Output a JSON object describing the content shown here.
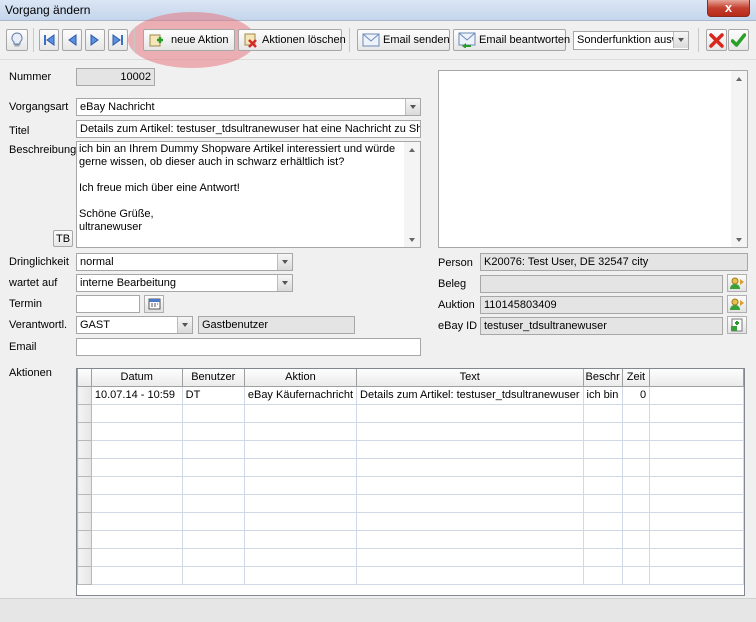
{
  "window": {
    "title": "Vorgang ändern",
    "close_label": "x"
  },
  "toolbar": {
    "neue_aktion": "neue Aktion",
    "aktionen_loeschen": "Aktionen löschen",
    "email_senden": "Email senden",
    "email_beantworten": "Email beantworten",
    "sonderfunktion": "Sonderfunktion ausw"
  },
  "form": {
    "nummer": {
      "label": "Nummer",
      "value": "10002"
    },
    "vorgangsart": {
      "label": "Vorgangsart",
      "value": "eBay Nachricht"
    },
    "titel": {
      "label": "Titel",
      "value": "Details zum Artikel: testuser_tdsultranewuser hat eine Nachricht zu Shop"
    },
    "beschreibung": {
      "label": "Beschreibung",
      "lines": [
        "ich bin an Ihrem Dummy Shopware Artikel interessiert und würde",
        "gerne wissen, ob dieser auch in schwarz erhältlich ist?",
        "",
        "Ich freue mich über eine Antwort!",
        "",
        "Schöne Grüße,",
        "ultranewuser"
      ],
      "tb_button": "TB"
    },
    "dringlichkeit": {
      "label": "Dringlichkeit",
      "value": "normal"
    },
    "wartet_auf": {
      "label": "wartet auf",
      "value": "interne Bearbeitung"
    },
    "termin": {
      "label": "Termin",
      "value": ""
    },
    "verantwortl": {
      "label": "Verantwortl.",
      "value": "GAST",
      "name": "Gastbenutzer"
    },
    "email": {
      "label": "Email",
      "value": ""
    },
    "aktionen": {
      "label": "Aktionen"
    }
  },
  "right": {
    "person": {
      "label": "Person",
      "value": "K20076: Test User, DE 32547 city"
    },
    "beleg": {
      "label": "Beleg",
      "value": ""
    },
    "auktion": {
      "label": "Auktion",
      "value": "110145803409"
    },
    "ebay_id": {
      "label": "eBay ID",
      "value": "testuser_tdsultranewuser"
    }
  },
  "grid": {
    "columns": [
      "Datum",
      "Benutzer",
      "Aktion",
      "Text",
      "Beschr",
      "Zeit"
    ],
    "rows": [
      [
        "10.07.14 - 10:59",
        "DT",
        "eBay Käufernachricht",
        "Details zum Artikel: testuser_tdsultranewuser",
        "ich bin",
        "0"
      ]
    ]
  }
}
